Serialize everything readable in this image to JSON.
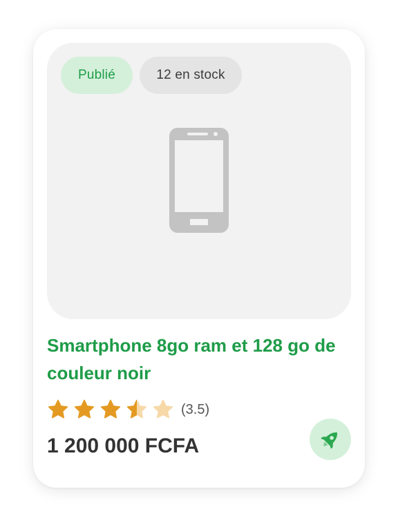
{
  "badges": {
    "status": "Publié",
    "stock": "12 en stock"
  },
  "product": {
    "title": "Smartphone 8go ram et 128 go de couleur noir",
    "rating_value": 3.5,
    "rating_max": 5,
    "rating_text": "(3.5)",
    "price": "1 200 000 FCFA",
    "image_icon": "smartphone-icon"
  },
  "actions": {
    "boost_icon": "rocket-icon"
  },
  "colors": {
    "accent_green": "#1e9c48",
    "badge_green_bg": "#d4f0da",
    "star_filled": "#e49a22",
    "star_empty": "#f7d9a8"
  }
}
